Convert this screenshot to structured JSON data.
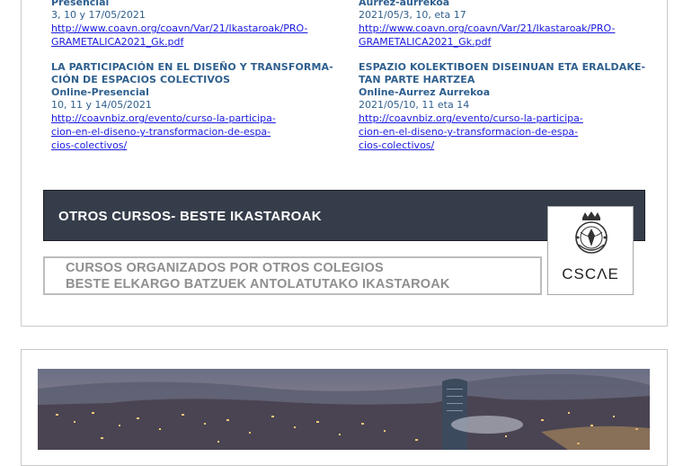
{
  "left_column": {
    "course1": {
      "mode": "Presencial",
      "dates": "3, 10 y 17/05/2021",
      "link": "http://www.coavn.org/coavn/Var/21/Ikastaroak/PRO-\nGRAMETALICA2021_Gk.pdf"
    },
    "course2": {
      "title": "LA PARTICIPACIÓN EN EL DISEÑO Y TRANSFORMA-\nCIÓN DE ESPACIOS COLECTIVOS",
      "mode": "Online-Presencial",
      "dates": "10, 11 y 14/05/2021",
      "link": "http://coavnbiz.org/evento/curso-la-participa-\ncion-en-el-diseno-y-transformacion-de-espa-\ncios-colectivos/"
    }
  },
  "right_column": {
    "course1": {
      "mode": "Aurrez-aurrekoa",
      "dates": "2021/05/3, 10, eta 17",
      "link": "http://www.coavn.org/coavn/Var/21/Ikastaroak/PRO-\nGRAMETALICA2021_Gk.pdf"
    },
    "course2": {
      "title": "ESPAZIO KOLEKTIBOEN DISEINUAN ETA ERALDAKE-\nTAN PARTE HARTZEA",
      "mode": "Online-Aurrez Aurrekoa",
      "dates": "2021/05/10, 11 eta 14",
      "link": "http://coavnbiz.org/evento/curso-la-participa-\ncion-en-el-diseno-y-transformacion-de-espa-\ncios-colectivos/"
    }
  },
  "section": {
    "title": "OTROS  CURSOS- BESTE  IKASTAROAK",
    "subtitle_line1": "CURSOS ORGANIZADOS POR OTROS COLEGIOS",
    "subtitle_line2": "BESTE ELKARGO BATZUEK ANTOLATUTAKO IKASTAROAK",
    "logo_text": "CSCΛE"
  },
  "colors": {
    "heading_blue": "#2e5f8e",
    "link_blue": "#1a1ae0",
    "banner_dark": "#363d4a",
    "banner_light_text": "#8f8f8f"
  }
}
